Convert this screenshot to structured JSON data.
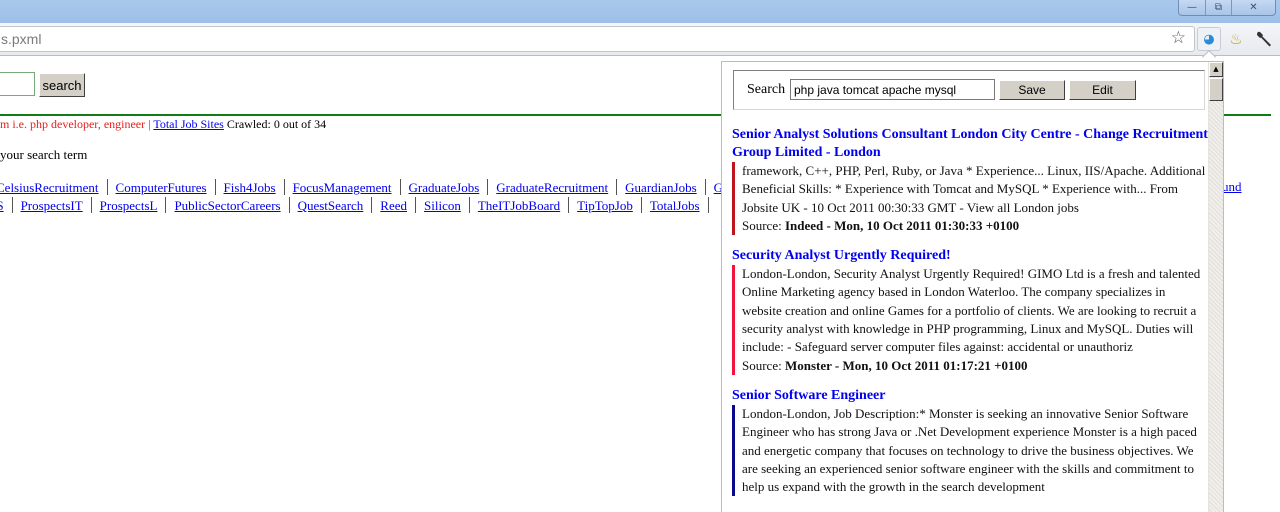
{
  "window": {
    "controls": {
      "minimize": "—",
      "restore": "⧉",
      "close": "✕"
    }
  },
  "browser": {
    "address_text": "s.pxml",
    "icons": {
      "bookmark": "☆",
      "extension_fish": "◕",
      "extension_news": "♨",
      "settings_wrench": "🔧"
    }
  },
  "page": {
    "search_button": "search",
    "status": {
      "hint": "m i.e. php developer, engineer",
      "separator": "|",
      "total_sites_link": "Total Job Sites",
      "crawled": "Crawled: 0 out of 34"
    },
    "search_term_text": "your search term",
    "job_sites_row1": [
      "CelsiusRecruitment",
      "ComputerFutures",
      "Fish4Jobs",
      "FocusManagement",
      "GraduateJobs",
      "GraduateRecruitment",
      "GuardianJobs",
      "G"
    ],
    "job_sites_row2": [
      "IS",
      "ProspectsIT",
      "ProspectsL",
      "PublicSectorCareers",
      "QuestSearch",
      "Reed",
      "Silicon",
      "TheITJobBoard",
      "TipTopJob",
      "TotalJobs"
    ],
    "trailing_link": "und"
  },
  "popup": {
    "search_label": "Search",
    "search_value": "php java tomcat apache mysql",
    "save_label": "Save",
    "edit_label": "Edit",
    "scroll_up": "▲",
    "results": [
      {
        "title": "Senior Analyst Solutions Consultant London City Centre - Change Recruitment Group Limited - London",
        "description": "framework, C++, PHP, Perl, Ruby, or Java * Experience... Linux, IIS/Apache. Additional Beneficial Skills: * Experience with Tomcat and MySQL * Experience with... From Jobsite UK - 10 Oct 2011 00:30:33 GMT - View all London jobs",
        "source_label": "Source:",
        "source": "Indeed - Mon, 10 Oct 2011 01:30:33 +0100",
        "accent": "#c0141c"
      },
      {
        "title": "Security Analyst Urgently Required!",
        "description": "London-London, Security Analyst Urgently Required! GIMO Ltd is a fresh and talented Online Marketing agency based in London Waterloo. The company specializes in website creation and online Games for a portfolio of clients. We are looking to recruit a security analyst with knowledge in PHP programming, Linux and MySQL. Duties will include: - Safeguard server computer files against: accidental or unauthoriz",
        "source_label": "Source:",
        "source": "Monster - Mon, 10 Oct 2011 01:17:21 +0100",
        "accent": "#f0143c"
      },
      {
        "title": "Senior Software Engineer",
        "description": "London-London, Job Description:* Monster is seeking an innovative Senior Software Engineer who has strong Java or .Net Development experience Monster is a high paced and energetic company that focuses on technology to drive the business objectives. We are seeking an experienced senior software engineer with the skills and commitment to help us expand with the growth in the search development",
        "source_label": "",
        "source": "",
        "accent": "#0a0a8c"
      }
    ]
  },
  "colors": {
    "link": "#0000ee",
    "hint_red": "#e8201c",
    "rule_green": "#137a13"
  }
}
